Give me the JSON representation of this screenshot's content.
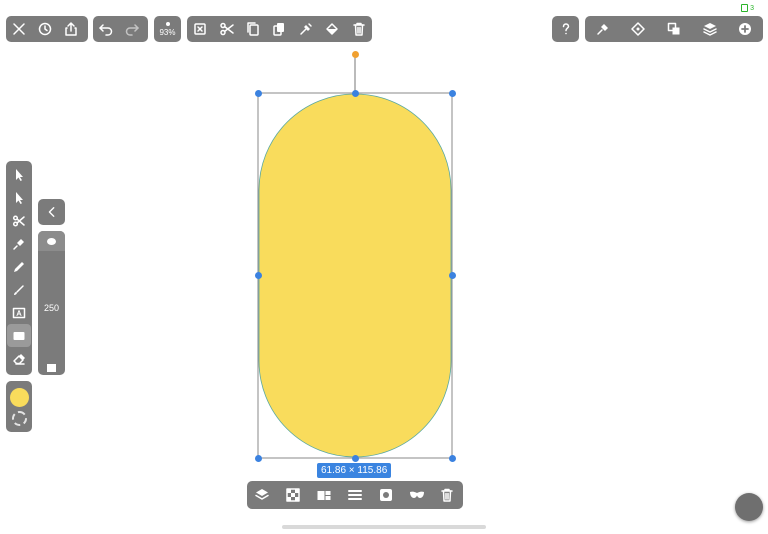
{
  "status": {
    "battery": "3"
  },
  "toolbar": {
    "zoom": "93%"
  },
  "size_panel": {
    "value": "250"
  },
  "shape": {
    "fill": "#f9dc5c",
    "stroke": "#5aa8a0",
    "dimensions": "61.86 × 115.86"
  },
  "colors": {
    "primary": "#f9dc5c",
    "selection": "#3b82e0",
    "rotation_handle": "#f0a030",
    "toolbar_bg": "#7b7b7b"
  }
}
